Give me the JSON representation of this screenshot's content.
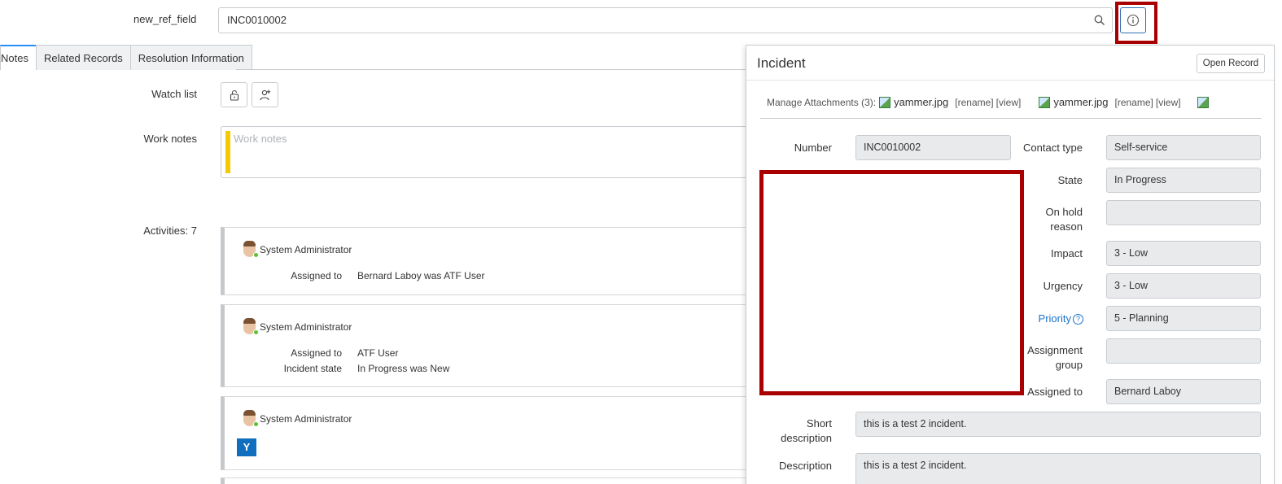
{
  "reference_field": {
    "label": "new_ref_field",
    "value": "INC0010002",
    "search_icon": "search-icon",
    "info_icon": "info-icon"
  },
  "tabs": [
    {
      "label": "Notes",
      "active": true
    },
    {
      "label": "Related Records",
      "active": false
    },
    {
      "label": "Resolution Information",
      "active": false
    }
  ],
  "form": {
    "watch_list_label": "Watch list",
    "work_notes_label": "Work notes",
    "work_notes_placeholder": "Work notes",
    "activities_label": "Activities: 7"
  },
  "activities": [
    {
      "user": "System Administrator",
      "changes": [
        {
          "field": "Assigned to",
          "value": "Bernard Laboy was ATF User"
        }
      ]
    },
    {
      "user": "System Administrator",
      "changes": [
        {
          "field": "Assigned to",
          "value": "ATF User"
        },
        {
          "field": "Incident state",
          "value": "In Progress was New"
        }
      ]
    },
    {
      "user": "System Administrator",
      "attachment_icon": "Y"
    }
  ],
  "panel": {
    "title": "Incident",
    "open_record": "Open Record",
    "manage_attachments": "Manage Attachments (3):",
    "attachments": [
      {
        "name": "yammer.jpg",
        "rename": "[rename]",
        "view": "[view]"
      },
      {
        "name": "yammer.jpg",
        "rename": "[rename]",
        "view": "[view]"
      }
    ],
    "fields": {
      "number": {
        "label": "Number",
        "value": "INC0010002"
      },
      "contact_type": {
        "label": "Contact type",
        "value": "Self-service"
      },
      "state": {
        "label": "State",
        "value": "In Progress"
      },
      "on_hold_reason": {
        "label_1": "On hold",
        "label_2": "reason",
        "value": ""
      },
      "impact": {
        "label": "Impact",
        "value": "3 - Low"
      },
      "urgency": {
        "label": "Urgency",
        "value": "3 - Low"
      },
      "priority": {
        "label": "Priority",
        "value": "5 - Planning"
      },
      "assignment_group": {
        "label_1": "Assignment",
        "label_2": "group",
        "value": ""
      },
      "assigned_to": {
        "label": "Assigned to",
        "value": "Bernard Laboy"
      },
      "short_description": {
        "label_1": "Short",
        "label_2": "description",
        "value": "this is a test 2 incident."
      },
      "description": {
        "label": "Description",
        "value": "this is a test 2 incident."
      }
    }
  },
  "colors": {
    "highlight": "#a80000",
    "accent": "#278efc",
    "link": "#1a73c9",
    "work_notes_bar": "#f5c900"
  }
}
